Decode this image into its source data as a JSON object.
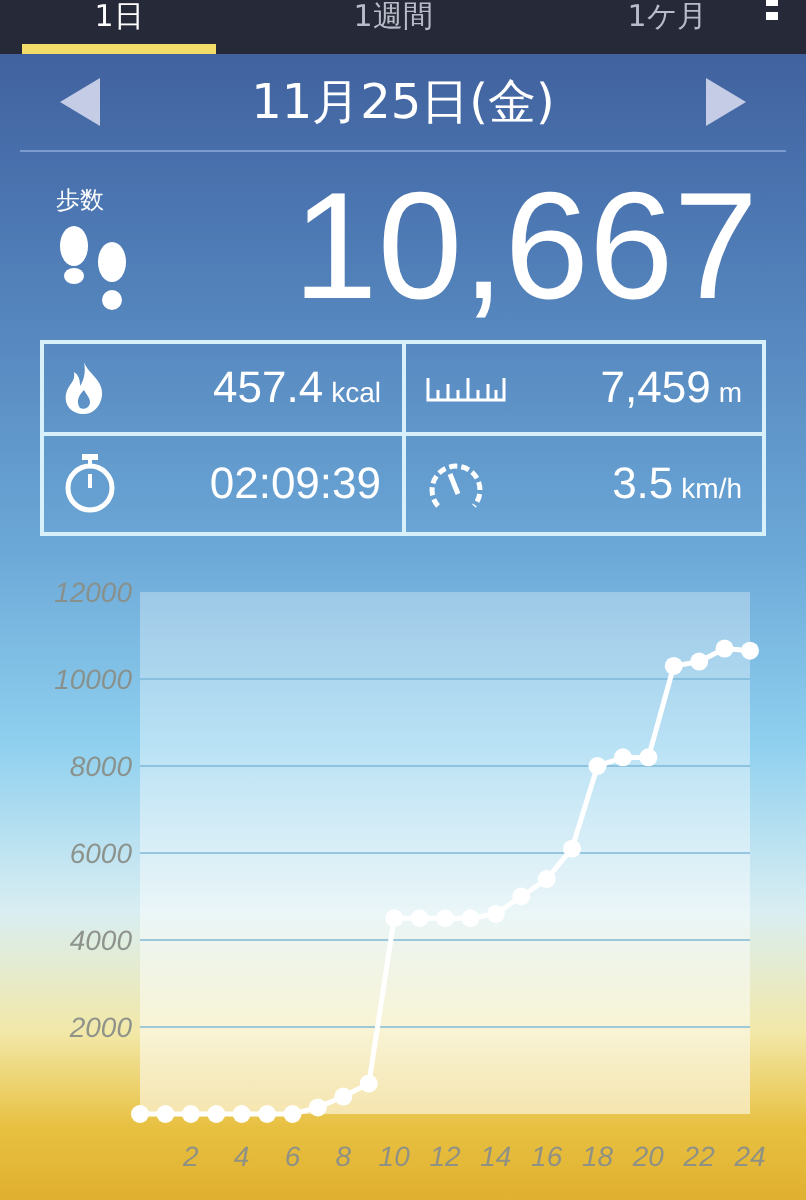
{
  "tabs": [
    {
      "label": "1日",
      "selected": true
    },
    {
      "label": "1週間",
      "selected": false
    },
    {
      "label": "1ケ月",
      "selected": false
    }
  ],
  "date_nav": {
    "date": "11月25日(金)"
  },
  "steps": {
    "label": "歩数",
    "value": "10,667"
  },
  "stats": [
    {
      "kind": "calories",
      "value": "457.4",
      "unit": "kcal"
    },
    {
      "kind": "distance",
      "value": "7,459",
      "unit": "m"
    },
    {
      "kind": "time",
      "value": "02:09:39"
    },
    {
      "kind": "speed",
      "value": "3.5",
      "unit": "km/h"
    }
  ],
  "chart_data": {
    "type": "line",
    "x": [
      0,
      1,
      2,
      3,
      4,
      5,
      6,
      7,
      8,
      9,
      10,
      11,
      12,
      13,
      14,
      15,
      16,
      17,
      18,
      19,
      20,
      21,
      22,
      23,
      24
    ],
    "series": [
      {
        "color": "#ffffff",
        "marker": "circle",
        "values": [
          0,
          0,
          0,
          0,
          0,
          0,
          0,
          150,
          400,
          700,
          4500,
          4500,
          4500,
          4500,
          4600,
          5000,
          5400,
          6100,
          8000,
          8200,
          8200,
          10300,
          10400,
          10700,
          10650
        ]
      }
    ],
    "grid": true,
    "xlim": [
      0,
      24
    ],
    "ylim": [
      0,
      12000
    ],
    "xticks": [
      2,
      4,
      6,
      8,
      10,
      12,
      14,
      16,
      18,
      20,
      22,
      24
    ],
    "yticks": [
      2000,
      4000,
      6000,
      8000,
      10000,
      12000
    ]
  }
}
